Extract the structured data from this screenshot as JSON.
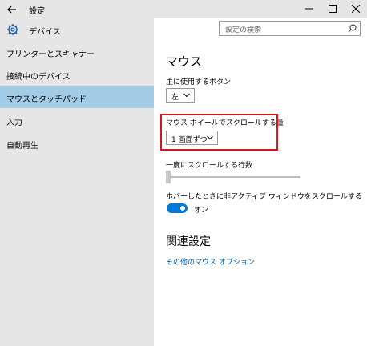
{
  "window": {
    "title": "設定",
    "controls": {
      "minimize": "minimize-icon",
      "maximize": "maximize-icon",
      "close": "close-icon"
    }
  },
  "sidebar": {
    "header_label": "デバイス",
    "items": [
      {
        "label": "プリンターとスキャナー",
        "selected": false
      },
      {
        "label": "接続中のデバイス",
        "selected": false
      },
      {
        "label": "マウスとタッチパッド",
        "selected": true
      },
      {
        "label": "入力",
        "selected": false
      },
      {
        "label": "自動再生",
        "selected": false
      }
    ]
  },
  "search": {
    "placeholder": "設定の検索"
  },
  "main": {
    "title": "マウス",
    "primary_button": {
      "label": "主に使用するボタン",
      "value": "左"
    },
    "wheel_scroll": {
      "label": "マウス ホイールでスクロールする量",
      "value": "1 画面ずつ"
    },
    "lines_to_scroll": {
      "label": "一度にスクロールする行数",
      "level": 0
    },
    "inactive_scroll": {
      "label": "ホバーしたときに非アクティブ ウィンドウをスクロールする",
      "state": "オン"
    },
    "related_title": "関連設定",
    "related_link": "その他のマウス オプション"
  },
  "colors": {
    "accent": "#0078d7",
    "selection": "#a3cbe6",
    "highlight_border": "#d4161e",
    "link": "#0063b1"
  }
}
